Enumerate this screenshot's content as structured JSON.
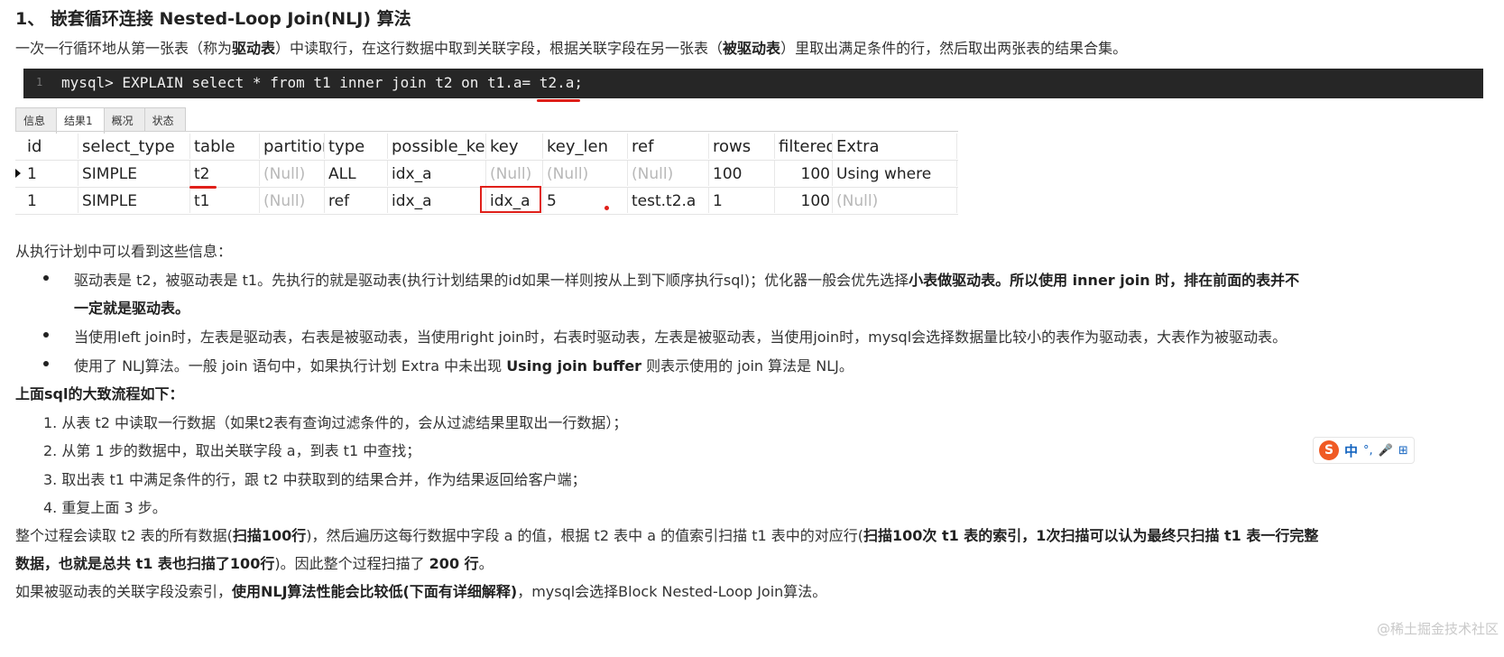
{
  "heading": "1、 嵌套循环连接 Nested-Loop Join(NLJ) 算法",
  "intro": {
    "t1": "一次一行循环地从第一张表（称为",
    "b1": "驱动表",
    "t2": "）中读取行，在这行数据中取到关联字段，根据关联字段在另一张表（",
    "b2": "被驱动表",
    "t3": "）里取出满足条件的行，然后取出两张表的结果合集。"
  },
  "code": {
    "line_no": "1",
    "text": "mysql> EXPLAIN select * from t1 inner join t2 on t1.a= t2.a;"
  },
  "tabs": [
    "信息",
    "结果1",
    "概况",
    "状态"
  ],
  "table": {
    "headers": [
      "id",
      "select_type",
      "table",
      "partitions",
      "type",
      "possible_keys",
      "key",
      "key_len",
      "ref",
      "rows",
      "filtered",
      "Extra"
    ],
    "rows": [
      [
        "1",
        "SIMPLE",
        "t2",
        "(Null)",
        "ALL",
        "idx_a",
        "(Null)",
        "(Null)",
        "(Null)",
        "100",
        "100",
        "Using where"
      ],
      [
        "1",
        "SIMPLE",
        "t1",
        "(Null)",
        "ref",
        "idx_a",
        "idx_a",
        "5",
        "test.t2.a",
        "1",
        "100",
        "(Null)"
      ]
    ]
  },
  "info_title": "从执行计划中可以看到这些信息：",
  "bullets": {
    "b1_t1": "驱动表是 t2，被驱动表是 t1。先执行的就是驱动表(执行计划结果的id如果一样则按从上到下顺序执行sql)；优化器一般会优先选择",
    "b1_b1": "小表做驱动表。所以使用 inner join 时，排在前面的表并不",
    "b1_b2": "一定就是驱动表。",
    "b2": "当使用left join时，左表是驱动表，右表是被驱动表，当使用right join时，右表时驱动表，左表是被驱动表，当使用join时，mysql会选择数据量比较小的表作为驱动表，大表作为被驱动表。",
    "b3_t1": "使用了 NLJ算法。一般 join 语句中，如果执行计划 Extra 中未出现 ",
    "b3_b": "Using join buffer",
    "b3_t2": " 则表示使用的 join 算法是 NLJ。"
  },
  "flow_title": "上面sql的大致流程如下：",
  "steps": [
    "1. 从表 t2 中读取一行数据（如果t2表有查询过滤条件的，会从过滤结果里取出一行数据）；",
    "2. 从第 1 步的数据中，取出关联字段 a，到表 t1 中查找；",
    "3. 取出表 t1 中满足条件的行，跟 t2 中获取到的结果合并，作为结果返回给客户端；",
    "4. 重复上面 3 步。"
  ],
  "summary": {
    "t1": "整个过程会读取 t2 表的所有数据(",
    "b1": "扫描100行",
    "t2": ")，然后遍历这每行数据中字段 a 的值，根据 t2 表中 a 的值索引扫描 t1 表中的对应行(",
    "b2": "扫描100次 t1 表的索引，1次扫描可以认为最终只扫描 t1 表一行完整",
    "b3": "数据，也就是总共 t1 表也扫描了100行",
    "t3": ")。因此整个过程扫描了 ",
    "b4": "200 行",
    "t4": "。"
  },
  "last": {
    "t1": "如果被驱动表的关联字段没索引，",
    "b1": "使用NLJ算法性能会比较低(下面有详细解释)",
    "t2": "，mysql会选择Block Nested-Loop Join算法。"
  },
  "ime": {
    "logo": "S",
    "lang": "中",
    "punct": "°,",
    "mic": "🎤",
    "grid": "⊞"
  },
  "watermark": "@稀土掘金技术社区",
  "colors": {
    "annotation_red": "#e0201a",
    "code_bg": "#262626",
    "null_gray": "#b8b8b8"
  }
}
